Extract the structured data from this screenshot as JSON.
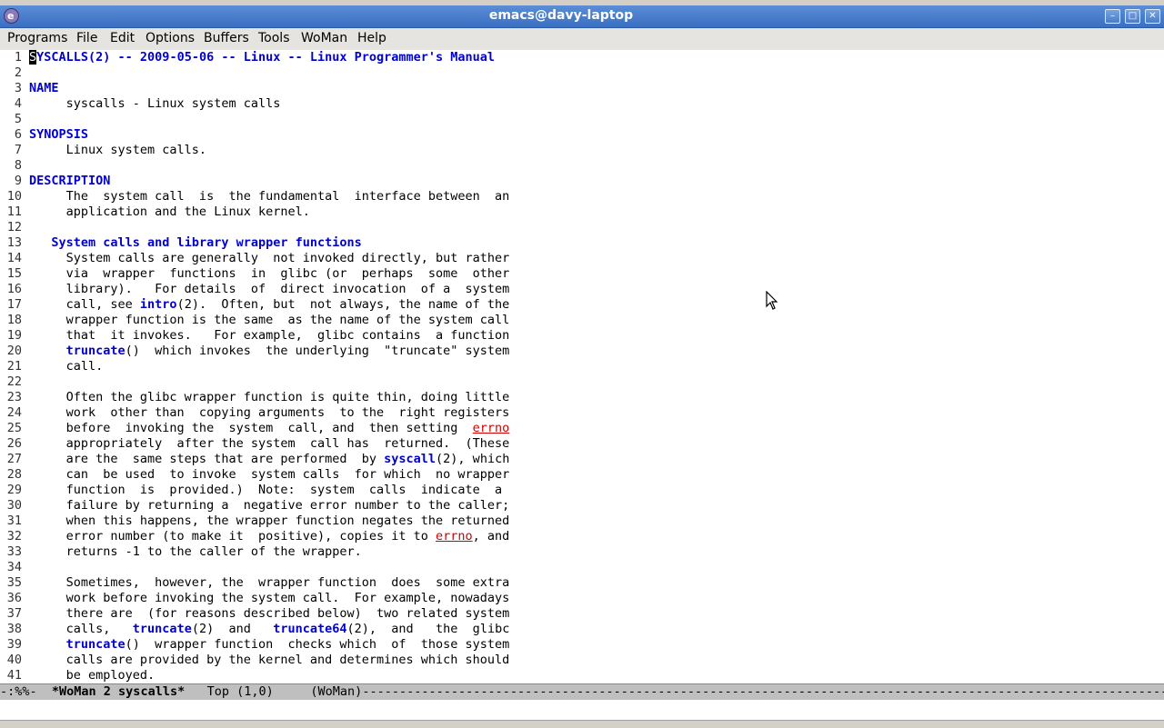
{
  "window": {
    "title": "emacs@davy-laptop"
  },
  "menubar": {
    "items": [
      "Programs",
      "File",
      "Edit",
      "Options",
      "Buffers",
      "Tools",
      "WoMan",
      "Help"
    ]
  },
  "buffer": {
    "lines": [
      {
        "n": "1",
        "segs": [
          {
            "t": "S",
            "c": "cursor"
          },
          {
            "t": "YSCALLS(2) -- 2009-05-06 -- Linux -- Linux Programmer's Manual",
            "c": "hd"
          }
        ]
      },
      {
        "n": "2",
        "segs": []
      },
      {
        "n": "3",
        "segs": [
          {
            "t": "NAME",
            "c": "hd"
          }
        ]
      },
      {
        "n": "4",
        "segs": [
          {
            "t": "     syscalls - Linux system calls"
          }
        ]
      },
      {
        "n": "5",
        "segs": []
      },
      {
        "n": "6",
        "segs": [
          {
            "t": "SYNOPSIS",
            "c": "hd"
          }
        ]
      },
      {
        "n": "7",
        "segs": [
          {
            "t": "     Linux system calls."
          }
        ]
      },
      {
        "n": "8",
        "segs": []
      },
      {
        "n": "9",
        "segs": [
          {
            "t": "DESCRIPTION",
            "c": "hd"
          }
        ]
      },
      {
        "n": "10",
        "segs": [
          {
            "t": "     The  system call  is  the fundamental  interface between  an"
          }
        ]
      },
      {
        "n": "11",
        "segs": [
          {
            "t": "     application and the Linux kernel."
          }
        ]
      },
      {
        "n": "12",
        "segs": []
      },
      {
        "n": "13",
        "segs": [
          {
            "t": "   "
          },
          {
            "t": "System calls and library wrapper functions",
            "c": "hd"
          }
        ]
      },
      {
        "n": "14",
        "segs": [
          {
            "t": "     System calls are generally  not invoked directly, but rather"
          }
        ]
      },
      {
        "n": "15",
        "segs": [
          {
            "t": "     via  wrapper  functions  in  glibc (or  perhaps  some  other"
          }
        ]
      },
      {
        "n": "16",
        "segs": [
          {
            "t": "     library).   For details  of  direct invocation  of a  system"
          }
        ]
      },
      {
        "n": "17",
        "segs": [
          {
            "t": "     call, see "
          },
          {
            "t": "intro",
            "c": "ref"
          },
          {
            "t": "(2).  Often, but  not always, the name of the"
          }
        ]
      },
      {
        "n": "18",
        "segs": [
          {
            "t": "     wrapper function is the same  as the name of the system call"
          }
        ]
      },
      {
        "n": "19",
        "segs": [
          {
            "t": "     that  it invokes.   For example,  glibc contains  a function"
          }
        ]
      },
      {
        "n": "20",
        "segs": [
          {
            "t": "     "
          },
          {
            "t": "truncate",
            "c": "ref"
          },
          {
            "t": "()  which invokes  the underlying  \"truncate\" system"
          }
        ]
      },
      {
        "n": "21",
        "segs": [
          {
            "t": "     call."
          }
        ]
      },
      {
        "n": "22",
        "segs": []
      },
      {
        "n": "23",
        "segs": [
          {
            "t": "     Often the glibc wrapper function is quite thin, doing little"
          }
        ]
      },
      {
        "n": "24",
        "segs": [
          {
            "t": "     work  other than  copying arguments  to the  right registers"
          }
        ]
      },
      {
        "n": "25",
        "segs": [
          {
            "t": "     before  invoking the  system  call, and  then setting  "
          },
          {
            "t": "errno",
            "c": "err"
          }
        ]
      },
      {
        "n": "26",
        "segs": [
          {
            "t": "     appropriately  after the system  call has  returned.  (These"
          }
        ]
      },
      {
        "n": "27",
        "segs": [
          {
            "t": "     are the  same steps that are performed  by "
          },
          {
            "t": "syscall",
            "c": "ref"
          },
          {
            "t": "(2), which"
          }
        ]
      },
      {
        "n": "28",
        "segs": [
          {
            "t": "     can  be used  to invoke  system calls  for which  no wrapper"
          }
        ]
      },
      {
        "n": "29",
        "segs": [
          {
            "t": "     function  is  provided.)  Note:  system  calls  indicate  a"
          }
        ]
      },
      {
        "n": "30",
        "segs": [
          {
            "t": "     failure by returning a  negative error number to the caller;"
          }
        ]
      },
      {
        "n": "31",
        "segs": [
          {
            "t": "     when this happens, the wrapper function negates the returned"
          }
        ]
      },
      {
        "n": "32",
        "segs": [
          {
            "t": "     error number (to make it  positive), copies it to "
          },
          {
            "t": "errno",
            "c": "err"
          },
          {
            "t": ", and"
          }
        ]
      },
      {
        "n": "33",
        "segs": [
          {
            "t": "     returns -1 to the caller of the wrapper."
          }
        ]
      },
      {
        "n": "34",
        "segs": []
      },
      {
        "n": "35",
        "segs": [
          {
            "t": "     Sometimes,  however, the  wrapper function  does  some extra"
          }
        ]
      },
      {
        "n": "36",
        "segs": [
          {
            "t": "     work before invoking the system call.  For example, nowadays"
          }
        ]
      },
      {
        "n": "37",
        "segs": [
          {
            "t": "     there are  (for reasons described below)  two related system"
          }
        ]
      },
      {
        "n": "38",
        "segs": [
          {
            "t": "     calls,   "
          },
          {
            "t": "truncate",
            "c": "ref"
          },
          {
            "t": "(2)  and   "
          },
          {
            "t": "truncate64",
            "c": "ref"
          },
          {
            "t": "(2),  and   the  glibc"
          }
        ]
      },
      {
        "n": "39",
        "segs": [
          {
            "t": "     "
          },
          {
            "t": "truncate",
            "c": "ref"
          },
          {
            "t": "()  wrapper function  checks which  of  those system"
          }
        ]
      },
      {
        "n": "40",
        "segs": [
          {
            "t": "     calls are provided by the kernel and determines which should"
          }
        ]
      },
      {
        "n": "41",
        "segs": [
          {
            "t": "     be employed."
          }
        ]
      }
    ]
  },
  "modeline": {
    "status": "-:%%-",
    "buffer_name": "*WoMan 2 syscalls*",
    "position": "Top (1,0)",
    "mode": "(WoMan)"
  },
  "icons": {
    "app": "emacs-icon",
    "minimize": "minimize-icon",
    "maximize": "maximize-icon",
    "close": "close-icon",
    "pointer": "mouse-pointer-icon"
  }
}
